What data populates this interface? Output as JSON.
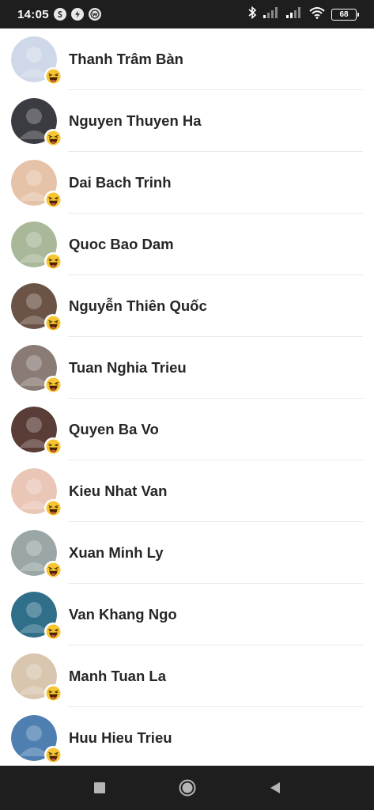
{
  "status_bar": {
    "time": "14:05",
    "battery": "68",
    "icons": [
      "s-icon",
      "bolt-icon",
      "w-icon",
      "bluetooth-icon",
      "signal-icon",
      "signal-icon",
      "wifi-icon",
      "battery-icon"
    ]
  },
  "reaction_icon": "laughing-face-icon",
  "people": [
    {
      "name": "Thanh Trâm Bàn",
      "avatar_color": "#cfd8e8"
    },
    {
      "name": "Nguyen Thuyen Ha",
      "avatar_color": "#3b3b42"
    },
    {
      "name": "Dai Bach Trinh",
      "avatar_color": "#e6c3a8"
    },
    {
      "name": "Quoc Bao Dam",
      "avatar_color": "#aab89a"
    },
    {
      "name": "Nguyễn Thiên Quốc",
      "avatar_color": "#6b5446"
    },
    {
      "name": "Tuan Nghia Trieu",
      "avatar_color": "#8a7b74"
    },
    {
      "name": "Quyen Ba Vo",
      "avatar_color": "#5a3d37"
    },
    {
      "name": "Kieu Nhat Van",
      "avatar_color": "#e9c6b6"
    },
    {
      "name": "Xuan Minh Ly",
      "avatar_color": "#9aa7a6"
    },
    {
      "name": "Van Khang Ngo",
      "avatar_color": "#2f6f8a"
    },
    {
      "name": "Manh Tuan La",
      "avatar_color": "#d8c6ae"
    },
    {
      "name": "Huu Hieu Trieu",
      "avatar_color": "#4e7fb0"
    }
  ],
  "nav_bar": {
    "buttons": [
      "recents-square-icon",
      "home-circle-icon",
      "back-triangle-icon"
    ]
  }
}
